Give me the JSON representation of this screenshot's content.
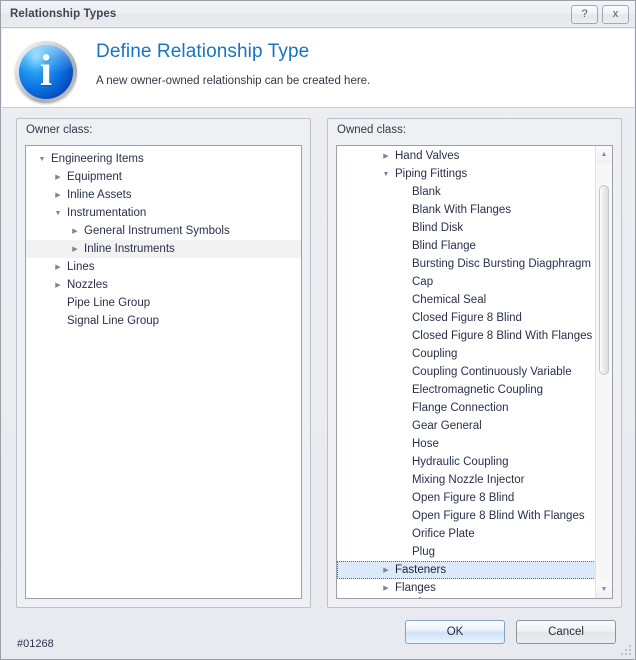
{
  "window": {
    "title": "Relationship Types",
    "help_button": "?",
    "close_button": "x"
  },
  "header": {
    "icon": "info-icon",
    "title": "Define Relationship Type",
    "subtitle": "A new owner-owned relationship can be created here."
  },
  "owner_panel": {
    "label": "Owner class:",
    "items": [
      {
        "label": "Engineering Items",
        "depth": 0,
        "arrow": "expanded",
        "state": "normal"
      },
      {
        "label": "Equipment",
        "depth": 1,
        "arrow": "collapsed",
        "state": "normal"
      },
      {
        "label": "Inline Assets",
        "depth": 1,
        "arrow": "collapsed",
        "state": "normal"
      },
      {
        "label": "Instrumentation",
        "depth": 1,
        "arrow": "expanded",
        "state": "normal"
      },
      {
        "label": "General Instrument Symbols",
        "depth": 2,
        "arrow": "collapsed",
        "state": "normal"
      },
      {
        "label": "Inline Instruments",
        "depth": 2,
        "arrow": "collapsed",
        "state": "hover"
      },
      {
        "label": "Lines",
        "depth": 1,
        "arrow": "collapsed",
        "state": "normal"
      },
      {
        "label": "Nozzles",
        "depth": 1,
        "arrow": "collapsed",
        "state": "normal"
      },
      {
        "label": "Pipe Line Group",
        "depth": 1,
        "arrow": "none",
        "state": "normal"
      },
      {
        "label": "Signal Line Group",
        "depth": 1,
        "arrow": "none",
        "state": "normal"
      }
    ]
  },
  "owned_panel": {
    "label": "Owned class:",
    "items": [
      {
        "label": "Hand Valves",
        "depth": 1,
        "arrow": "collapsed",
        "state": "normal"
      },
      {
        "label": "Piping Fittings",
        "depth": 1,
        "arrow": "expanded",
        "state": "normal"
      },
      {
        "label": "Blank",
        "depth": 2,
        "arrow": "none",
        "state": "normal"
      },
      {
        "label": "Blank With Flanges",
        "depth": 2,
        "arrow": "none",
        "state": "normal"
      },
      {
        "label": "Blind Disk",
        "depth": 2,
        "arrow": "none",
        "state": "normal"
      },
      {
        "label": "Blind Flange",
        "depth": 2,
        "arrow": "none",
        "state": "normal"
      },
      {
        "label": "Bursting Disc Bursting Diagphragm",
        "depth": 2,
        "arrow": "none",
        "state": "normal"
      },
      {
        "label": "Cap",
        "depth": 2,
        "arrow": "none",
        "state": "normal"
      },
      {
        "label": "Chemical Seal",
        "depth": 2,
        "arrow": "none",
        "state": "normal"
      },
      {
        "label": "Closed Figure 8 Blind",
        "depth": 2,
        "arrow": "none",
        "state": "normal"
      },
      {
        "label": "Closed Figure 8 Blind With Flanges",
        "depth": 2,
        "arrow": "none",
        "state": "normal"
      },
      {
        "label": "Coupling",
        "depth": 2,
        "arrow": "none",
        "state": "normal"
      },
      {
        "label": "Coupling Continuously Variable",
        "depth": 2,
        "arrow": "none",
        "state": "normal"
      },
      {
        "label": "Electromagnetic Coupling",
        "depth": 2,
        "arrow": "none",
        "state": "normal"
      },
      {
        "label": "Flange Connection",
        "depth": 2,
        "arrow": "none",
        "state": "normal"
      },
      {
        "label": "Gear General",
        "depth": 2,
        "arrow": "none",
        "state": "normal"
      },
      {
        "label": "Hose",
        "depth": 2,
        "arrow": "none",
        "state": "normal"
      },
      {
        "label": "Hydraulic Coupling",
        "depth": 2,
        "arrow": "none",
        "state": "normal"
      },
      {
        "label": "Mixing Nozzle Injector",
        "depth": 2,
        "arrow": "none",
        "state": "normal"
      },
      {
        "label": "Open Figure 8 Blind",
        "depth": 2,
        "arrow": "none",
        "state": "normal"
      },
      {
        "label": "Open Figure 8 Blind With Flanges",
        "depth": 2,
        "arrow": "none",
        "state": "normal"
      },
      {
        "label": "Orifice Plate",
        "depth": 2,
        "arrow": "none",
        "state": "normal"
      },
      {
        "label": "Plug",
        "depth": 2,
        "arrow": "none",
        "state": "normal"
      },
      {
        "label": "Fasteners",
        "depth": 1,
        "arrow": "collapsed",
        "state": "selected"
      },
      {
        "label": "Flanges",
        "depth": 1,
        "arrow": "collapsed",
        "state": "normal"
      },
      {
        "label": "Pump Electric Motor Drive Gearbox T",
        "depth": 1,
        "arrow": "collapsed",
        "state": "clipped"
      }
    ],
    "scrollbar": {
      "up_arrow": "scroll-up-icon",
      "down_arrow": "scroll-down-icon"
    }
  },
  "footer": {
    "status_id": "#01268",
    "ok_label": "OK",
    "cancel_label": "Cancel"
  }
}
